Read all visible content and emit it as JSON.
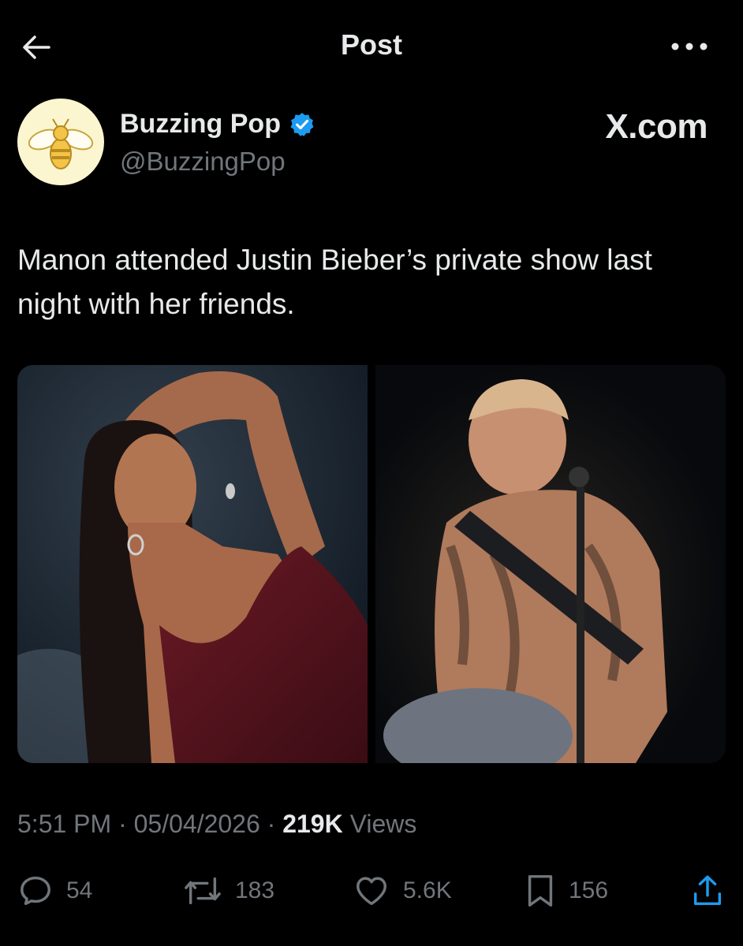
{
  "header": {
    "title": "Post"
  },
  "author": {
    "name": "Buzzing Pop",
    "handle": "@BuzzingPop",
    "verified": true
  },
  "brand": "X.com",
  "post": {
    "text": "Manon attended Justin Bieber’s private show last night with her friends."
  },
  "meta": {
    "time": "5:51 PM",
    "date": "05/04/2026",
    "views_count": "219K",
    "views_label": "Views",
    "separator": "·"
  },
  "actions": {
    "replies": "54",
    "reposts": "183",
    "likes": "5.6K",
    "bookmarks": "156"
  },
  "colors": {
    "background": "#000000",
    "text": "#e7e9ea",
    "muted": "#71767b",
    "verified": "#1d9bf0"
  },
  "icons": [
    "back-arrow-icon",
    "more-icon",
    "verified-badge-icon",
    "bee-logo-icon",
    "reply-icon",
    "repost-icon",
    "like-icon",
    "bookmark-icon",
    "share-icon"
  ]
}
